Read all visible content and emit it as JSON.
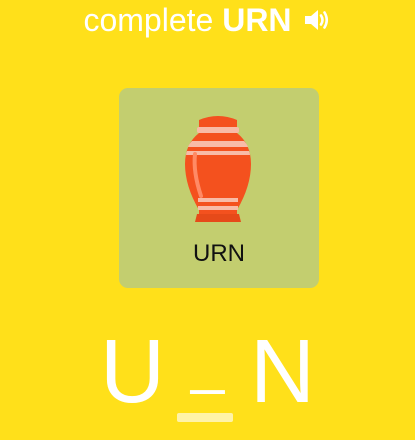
{
  "header": {
    "prompt": "complete",
    "word": "URN",
    "speaker_icon": "speaker-icon"
  },
  "card": {
    "image_icon": "urn-icon",
    "label": "URN"
  },
  "puzzle": {
    "letter_1": "U",
    "blank": "_",
    "letter_3": "N"
  },
  "colors": {
    "background": "#FFE01A",
    "card": "#C3CE6F",
    "text": "#ffffff",
    "urn": "#F4511E",
    "blank_underline": "#FFF3A8"
  }
}
